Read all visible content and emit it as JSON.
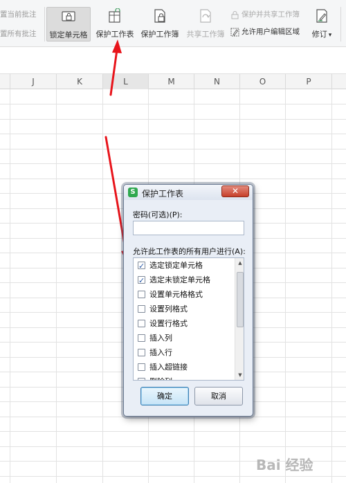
{
  "ribbon": {
    "left_items": [
      "置当前批注",
      "置所有批注"
    ],
    "buttons": [
      {
        "label": "锁定单元格",
        "icon": "lock-cell-icon",
        "state": "active"
      },
      {
        "label": "保护工作表",
        "icon": "protect-sheet-icon",
        "state": "normal"
      },
      {
        "label": "保护工作簿",
        "icon": "protect-workbook-icon",
        "state": "normal"
      },
      {
        "label": "共享工作簿",
        "icon": "share-workbook-icon",
        "state": "disabled"
      }
    ],
    "small_items": [
      {
        "label": "保护并共享工作簿",
        "icon": "lock-share-icon",
        "state": "disabled"
      },
      {
        "label": "允许用户编辑区域",
        "icon": "edit-range-icon",
        "state": "normal"
      }
    ],
    "revise": {
      "label": "修订",
      "icon": "revise-icon",
      "dropdown": "▾"
    }
  },
  "sheet": {
    "columns": [
      "J",
      "K",
      "L",
      "M",
      "N",
      "O",
      "P"
    ]
  },
  "dialog": {
    "title": "保护工作表",
    "app_icon_glyph": "S",
    "close_glyph": "✕",
    "password_label": "密码(可选)(P):",
    "password_value": "",
    "allow_label": "允许此工作表的所有用户进行(A):",
    "options": [
      {
        "label": "选定锁定单元格",
        "checked": true
      },
      {
        "label": "选定未锁定单元格",
        "checked": true
      },
      {
        "label": "设置单元格格式",
        "checked": false
      },
      {
        "label": "设置列格式",
        "checked": false
      },
      {
        "label": "设置行格式",
        "checked": false
      },
      {
        "label": "插入列",
        "checked": false
      },
      {
        "label": "插入行",
        "checked": false
      },
      {
        "label": "插入超链接",
        "checked": false
      },
      {
        "label": "删除列",
        "checked": false
      }
    ],
    "scroll_up": "▲",
    "scroll_down": "▼",
    "ok_label": "确定",
    "cancel_label": "取消"
  },
  "watermark": "Bai 经验",
  "colors": {
    "arrow": "#e8141b",
    "close_button": "#c6402a",
    "app_icon": "#2fa84f"
  }
}
